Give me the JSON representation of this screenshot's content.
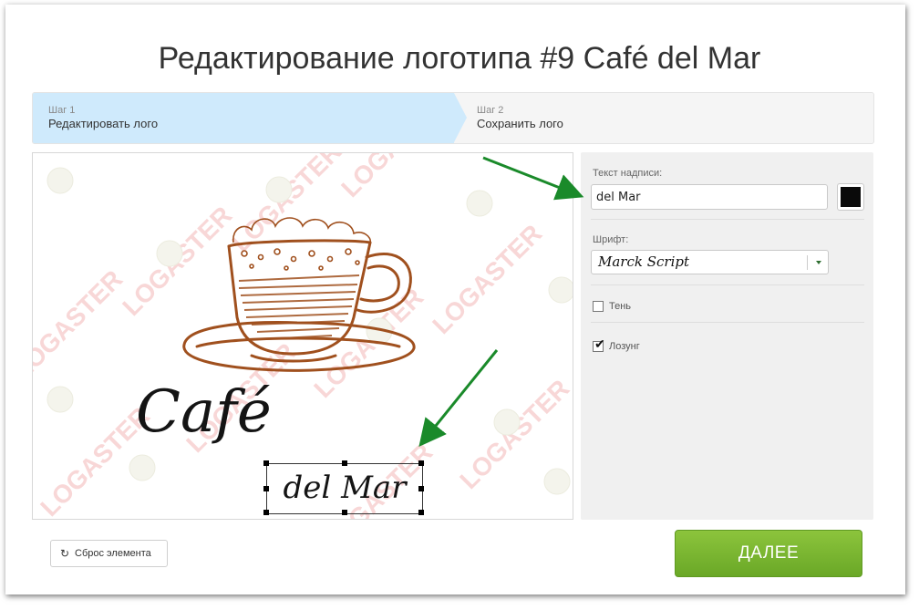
{
  "page_title": "Редактирование логотипа #9 Café del Mar",
  "steps": [
    {
      "number": "Шаг 1",
      "label": "Редактировать лого",
      "active": true
    },
    {
      "number": "Шаг 2",
      "label": "Сохранить лого",
      "active": false
    }
  ],
  "canvas": {
    "watermark_text": "LOGASTER",
    "logo_title": "Café",
    "logo_slogan": "del Mar",
    "cup_color": "#a0501e"
  },
  "panel": {
    "text_label": "Текст надписи:",
    "text_value": "del Mar",
    "text_color": "#0a0a0a",
    "font_label": "Шрифт:",
    "font_value": "Marck Script",
    "shadow_label": "Тень",
    "shadow_checked": false,
    "slogan_label": "Лозунг",
    "slogan_checked": true
  },
  "buttons": {
    "reset_label": "Сброс элемента",
    "reset_icon": "refresh-icon",
    "next_label": "ДАЛЕЕ"
  },
  "colors": {
    "active_step": "#cfeafc",
    "next_button": "#7cb733",
    "annotation_arrow": "#1a8a2a",
    "watermark": "#f3c4c4"
  }
}
